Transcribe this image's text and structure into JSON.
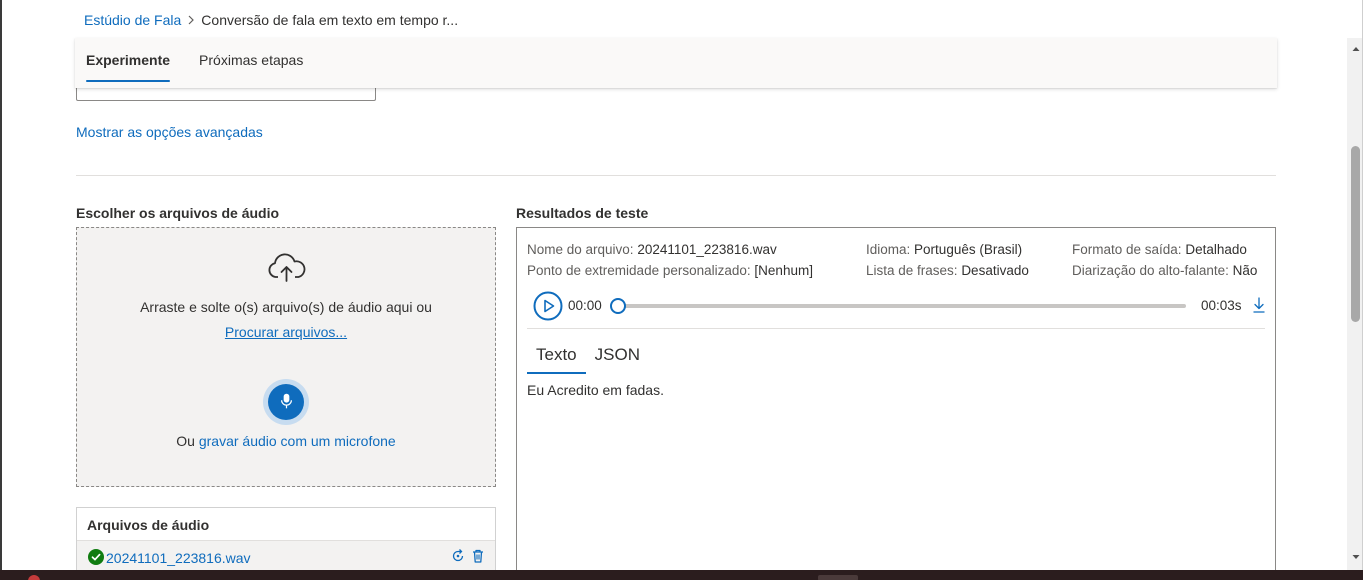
{
  "breadcrumb": {
    "root": "Estúdio de Fala",
    "current": "Conversão de fala em texto em tempo r..."
  },
  "tabs": [
    {
      "label": "Experimente",
      "active": true
    },
    {
      "label": "Próximas etapas",
      "active": false
    }
  ],
  "advanced_options_link": "Mostrar as opções avançadas",
  "upload": {
    "section_title": "Escolher os arquivos de áudio",
    "drop_text": "Arraste e solte o(s) arquivo(s) de áudio aqui ou",
    "browse_link": "Procurar arquivos...",
    "record_prefix": "Ou",
    "record_link": "gravar áudio com um microfone",
    "icon": "cloud-upload-icon",
    "mic_icon": "microphone-icon"
  },
  "audio_files": {
    "title": "Arquivos de áudio",
    "files": [
      {
        "name": "20241101_223816.wav",
        "status": "success"
      }
    ]
  },
  "results": {
    "section_title": "Resultados de teste",
    "file_name_label": "Nome do arquivo:",
    "file_name_value": "20241101_223816.wav",
    "language_label": "Idioma:",
    "language_value": "Português (Brasil)",
    "output_format_label": "Formato de saída:",
    "output_format_value": "Detalhado",
    "endpoint_label": "Ponto de extremidade personalizado:",
    "endpoint_value": "[Nenhum]",
    "phrase_list_label": "Lista de frases:",
    "phrase_list_value": "Desativado",
    "diarization_label": "Diarização do alto-falante:",
    "diarization_value": "Não",
    "player": {
      "current_time": "00:00",
      "duration": "00:03s",
      "progress": 0
    },
    "result_tabs": [
      {
        "label": "Texto",
        "active": true
      },
      {
        "label": "JSON",
        "active": false
      }
    ],
    "transcript": "Eu Acredito em fadas."
  },
  "colors": {
    "accent": "#0f6cbd",
    "success": "#107c10",
    "text": "#323130"
  }
}
